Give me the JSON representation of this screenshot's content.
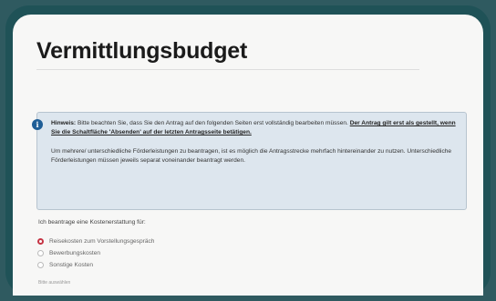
{
  "page": {
    "title": "Vermittlungsbudget"
  },
  "notice": {
    "label": "Hinweis:",
    "text1": " Bitte beachten Sie, dass Sie den Antrag auf den folgenden Seiten erst vollständig bearbeiten müssen. ",
    "emphasis": "Der Antrag gilt erst als gestellt, wenn Sie die Schaltfläche 'Absenden' auf der letzten Antragsseite betätigen.",
    "text2": "Um mehrere/ unterschiedliche Förderleistungen zu beantragen, ist es möglich die Antragsstrecke mehrfach hintereinander zu nutzen. Unterschiedliche Förderleistungen müssen jeweils separat voneinander beantragt werden.",
    "icon": "info-icon"
  },
  "form": {
    "question": "Ich beantrage eine Kostenerstattung für:",
    "options": [
      {
        "label": "Reisekosten zum Vorstellungsgespräch",
        "selected": true
      },
      {
        "label": "Bewerbungskosten",
        "selected": false
      },
      {
        "label": "Sonstige Kosten",
        "selected": false
      }
    ],
    "hint": "Bitte auswählen"
  },
  "colors": {
    "accent_radio": "#c53444",
    "notice_bg": "#dde6ee",
    "frame": "#1f5257",
    "info_icon": "#1f5e96"
  }
}
